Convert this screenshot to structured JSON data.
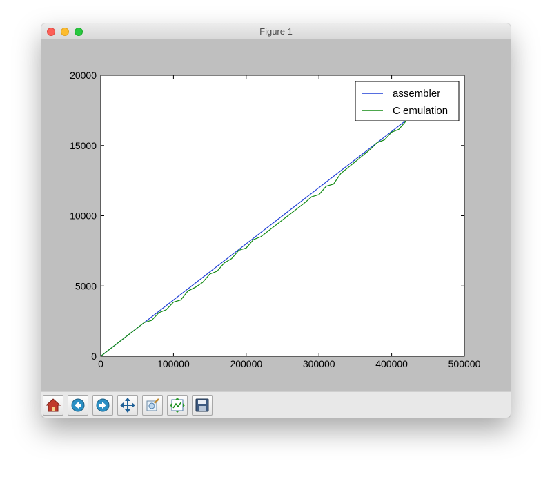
{
  "window": {
    "title": "Figure 1"
  },
  "toolbar": {
    "buttons": [
      {
        "icon": "home-icon"
      },
      {
        "icon": "back-icon"
      },
      {
        "icon": "forward-icon"
      },
      {
        "icon": "pan-icon"
      },
      {
        "icon": "zoom-icon"
      },
      {
        "icon": "subplots-icon"
      },
      {
        "icon": "save-icon"
      }
    ]
  },
  "chart_data": {
    "type": "line",
    "title": "",
    "xlabel": "",
    "ylabel": "",
    "xlim": [
      0,
      500000
    ],
    "ylim": [
      0,
      20000
    ],
    "xticks": [
      "0",
      "100000",
      "200000",
      "300000",
      "400000",
      "500000"
    ],
    "yticks": [
      "0",
      "5000",
      "10000",
      "15000",
      "20000"
    ],
    "legend_position": "top-right",
    "grid": false,
    "series": [
      {
        "name": "assembler",
        "color": "#1f3fd6",
        "x": [
          0,
          50000,
          100000,
          150000,
          200000,
          250000,
          300000,
          330000,
          380000,
          430000,
          445000
        ],
        "y": [
          0,
          2000,
          4000,
          6000,
          8000,
          10000,
          12000,
          13200,
          15200,
          17200,
          17800
        ]
      },
      {
        "name": "C emulation",
        "color": "#128a12",
        "x": [
          0,
          60000,
          70000,
          80000,
          90000,
          100000,
          110000,
          120000,
          130000,
          140000,
          150000,
          160000,
          170000,
          180000,
          190000,
          200000,
          210000,
          220000,
          240000,
          260000,
          280000,
          290000,
          300000,
          310000,
          320000,
          330000,
          350000,
          370000,
          380000,
          390000,
          400000,
          410000,
          420000,
          430000,
          440000
        ],
        "y": [
          0,
          2400,
          2550,
          3100,
          3300,
          3850,
          4000,
          4650,
          4900,
          5250,
          5850,
          6050,
          6650,
          6950,
          7550,
          7700,
          8300,
          8500,
          9300,
          10100,
          10900,
          11350,
          11500,
          12100,
          12250,
          13000,
          13850,
          14700,
          15200,
          15400,
          15950,
          16150,
          16750,
          17150,
          17700
        ]
      }
    ]
  }
}
